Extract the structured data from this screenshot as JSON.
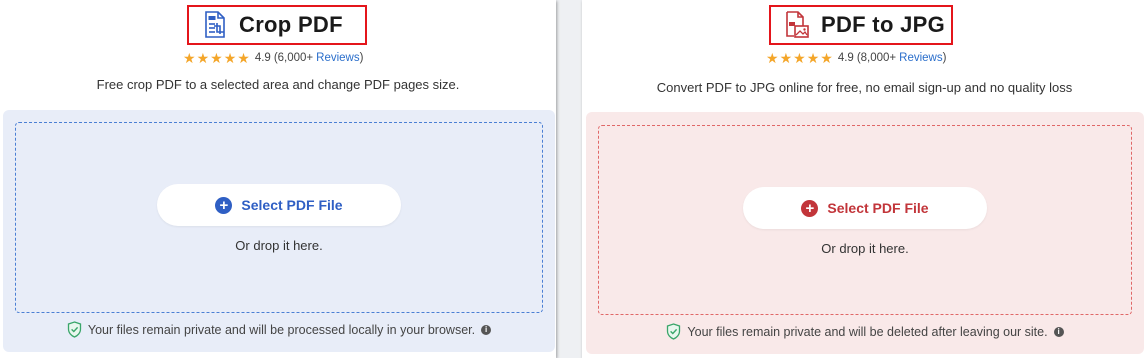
{
  "left": {
    "title": "Crop PDF",
    "rating": "4.9",
    "rating_count": "(6,000+",
    "reviews_link": "Reviews",
    "reviews_close": ")",
    "subtitle": "Free crop PDF to a selected area and change PDF pages size.",
    "button_label": "Select PDF File",
    "drop_text": "Or drop it here.",
    "privacy_text": "Your files remain private and will be processed locally in your browser.",
    "accent": "#2f5fc4",
    "icon": "crop-pdf-icon"
  },
  "right": {
    "title": "PDF to JPG",
    "rating": "4.9",
    "rating_count": "(8,000+",
    "reviews_link": "Reviews",
    "reviews_close": ")",
    "subtitle": "Convert PDF to JPG online for free, no email sign-up and no quality loss",
    "button_label": "Select PDF File",
    "drop_text": "Or drop it here.",
    "privacy_text": "Your files remain private and will be deleted after leaving our site.",
    "accent": "#c2353a",
    "icon": "pdf-to-jpg-icon"
  },
  "stars": [
    "★",
    "★",
    "★",
    "★",
    "★"
  ],
  "info_glyph": "i",
  "plus_glyph": "+"
}
